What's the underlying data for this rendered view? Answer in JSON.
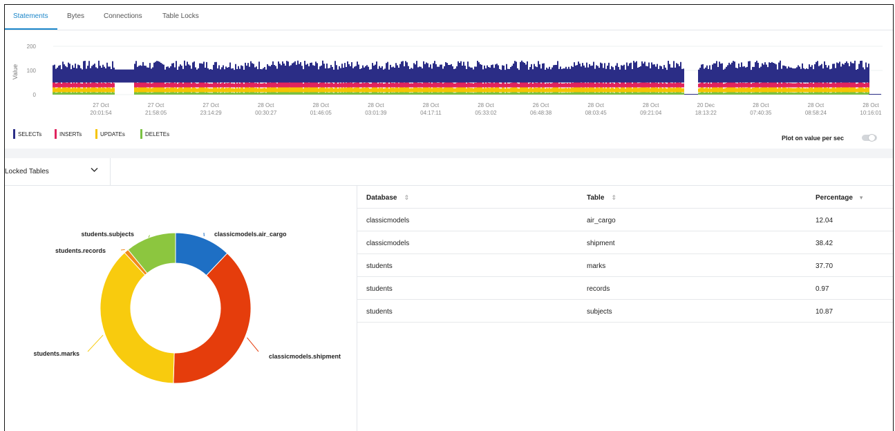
{
  "tabs": [
    {
      "label": "Statements",
      "active": true
    },
    {
      "label": "Bytes",
      "active": false
    },
    {
      "label": "Connections",
      "active": false
    },
    {
      "label": "Table Locks",
      "active": false
    }
  ],
  "chart_data": [
    {
      "type": "area",
      "ylabel": "Value",
      "ylim": [
        0,
        200
      ],
      "yticks": [
        "200",
        "100",
        "0"
      ],
      "xticks": [
        [
          "27 Oct",
          "20:01:54"
        ],
        [
          "27 Oct",
          "21:58:05"
        ],
        [
          "27 Oct",
          "23:14:29"
        ],
        [
          "28 Oct",
          "00:30:27"
        ],
        [
          "28 Oct",
          "01:46:05"
        ],
        [
          "28 Oct",
          "03:01:39"
        ],
        [
          "28 Oct",
          "04:17:11"
        ],
        [
          "28 Oct",
          "05:33:02"
        ],
        [
          "26 Oct",
          "06:48:38"
        ],
        [
          "28 Oct",
          "08:03:45"
        ],
        [
          "28 Oct",
          "09:21:04"
        ],
        [
          "20 Dec",
          "18:13:22"
        ],
        [
          "28 Oct",
          "07:40:35"
        ],
        [
          "28 Oct",
          "08:58:24"
        ],
        [
          "28 Oct",
          "10:16:01"
        ]
      ],
      "series": [
        {
          "name": "SELECTs",
          "color": "#2b2d86",
          "typical": 70
        },
        {
          "name": "INSERTs",
          "color": "#e0245e",
          "typical": 20
        },
        {
          "name": "UPDATEs",
          "color": "#f5c400",
          "typical": 20
        },
        {
          "name": "DELETEs",
          "color": "#7ac142",
          "typical": 10
        }
      ]
    },
    {
      "type": "pie",
      "title": "",
      "categories": [
        "classicmodels.air_cargo",
        "classicmodels.shipment",
        "students.marks",
        "students.records",
        "students.subjects"
      ],
      "values": [
        12.04,
        38.42,
        37.7,
        0.97,
        10.87
      ],
      "colors": [
        "#1e6fc4",
        "#e53d0c",
        "#f8cb0e",
        "#f08a1c",
        "#8cc63f"
      ]
    }
  ],
  "controls": {
    "plot_toggle_label": "Plot on value per sec",
    "plot_toggle_on": false,
    "selector_label": "Locked Tables",
    "selector_chevron": "chevron-down-icon"
  },
  "table": {
    "headers": [
      "Database",
      "Table",
      "Percentage"
    ],
    "sort_icons": [
      "⇕",
      "⇕",
      "▾"
    ],
    "rows": [
      {
        "database": "classicmodels",
        "table": "air_cargo",
        "percentage": "12.04"
      },
      {
        "database": "classicmodels",
        "table": "shipment",
        "percentage": "38.42"
      },
      {
        "database": "students",
        "table": "marks",
        "percentage": "37.70"
      },
      {
        "database": "students",
        "table": "records",
        "percentage": "0.97"
      },
      {
        "database": "students",
        "table": "subjects",
        "percentage": "10.87"
      }
    ]
  },
  "colors": {
    "accent": "#1b86c9",
    "border": "#e3e6ea"
  }
}
